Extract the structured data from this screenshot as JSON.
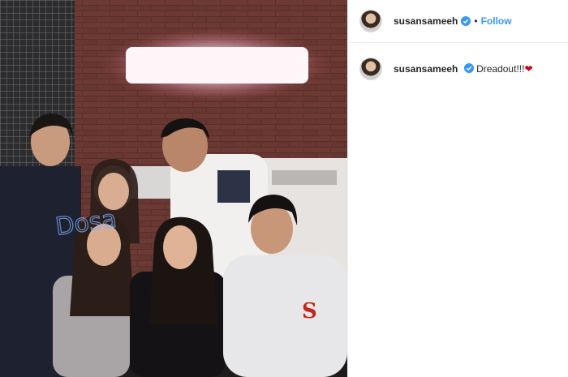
{
  "post": {
    "image_alt": "Group photo of six friends posing in front of a brick wall with a neon sign",
    "image_watermark": "Dosa"
  },
  "header": {
    "username": "susansameeh",
    "verified_icon": "verified-badge-icon",
    "separator": "•",
    "follow_label": "Follow"
  },
  "caption": {
    "username": "susansameeh",
    "verified_icon": "verified-badge-icon",
    "text": "Dreadout!!!",
    "emoji": "❤"
  },
  "colors": {
    "follow": "#3897f0",
    "verified": "#3897f0",
    "heart": "#d0021b",
    "divider": "#efefef"
  }
}
